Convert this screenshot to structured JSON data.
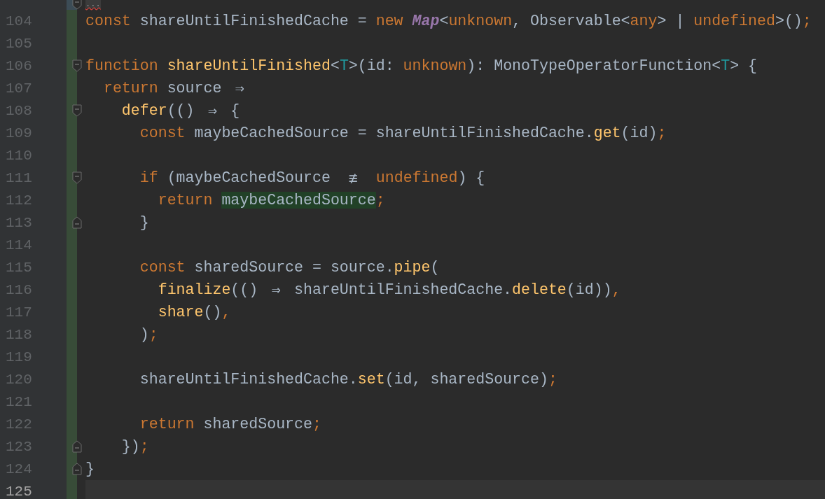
{
  "editor": {
    "lines": [
      {
        "kind": "fold-start",
        "current": false,
        "tokens": [
          {
            "t": "...",
            "kind": "folded"
          }
        ]
      },
      {
        "number": "104",
        "kind": "plain",
        "current": false,
        "tokens": [
          {
            "t": "const ",
            "kind": "kw"
          },
          {
            "t": "shareUntilFinishedCache = ",
            "kind": "plain"
          },
          {
            "t": "new ",
            "kind": "kw"
          },
          {
            "t": "Map",
            "kind": "class"
          },
          {
            "t": "<",
            "kind": "plain"
          },
          {
            "t": "unknown",
            "kind": "kw"
          },
          {
            "t": ", Observable<",
            "kind": "plain"
          },
          {
            "t": "any",
            "kind": "kw"
          },
          {
            "t": "> | ",
            "kind": "plain"
          },
          {
            "t": "undefined",
            "kind": "kw"
          },
          {
            "t": ">()",
            "kind": "plain"
          },
          {
            "t": ";",
            "kind": "kw"
          }
        ]
      },
      {
        "number": "105",
        "kind": "plain",
        "current": false
      },
      {
        "number": "106",
        "kind": "fold-start",
        "current": false,
        "tokens": [
          {
            "t": "function ",
            "kind": "kw"
          },
          {
            "t": "shareUntilFinished",
            "kind": "fn"
          },
          {
            "t": "<",
            "kind": "plain"
          },
          {
            "t": "T",
            "kind": "tparam"
          },
          {
            "t": ">(id: ",
            "kind": "plain"
          },
          {
            "t": "unknown",
            "kind": "kw"
          },
          {
            "t": "): MonoTypeOperatorFunction<",
            "kind": "plain"
          },
          {
            "t": "T",
            "kind": "tparam"
          },
          {
            "t": "> {",
            "kind": "plain"
          }
        ]
      },
      {
        "number": "107",
        "kind": "plain",
        "current": false,
        "tokens": [
          {
            "t": "  return ",
            "kind": "kw"
          },
          {
            "t": "source ",
            "kind": "plain"
          },
          {
            "t": "⇒",
            "kind": "arrow"
          }
        ]
      },
      {
        "number": "108",
        "kind": "fold-start",
        "current": false,
        "tokens": [
          {
            "t": "    defer",
            "kind": "fn"
          },
          {
            "t": "(() ",
            "kind": "plain"
          },
          {
            "t": "⇒",
            "kind": "arrow"
          },
          {
            "t": " {",
            "kind": "plain"
          }
        ]
      },
      {
        "number": "109",
        "kind": "plain",
        "current": false,
        "tokens": [
          {
            "t": "      const ",
            "kind": "kw"
          },
          {
            "t": "maybeCachedSource = shareUntilFinishedCache.",
            "kind": "plain"
          },
          {
            "t": "get",
            "kind": "fn"
          },
          {
            "t": "(id)",
            "kind": "plain"
          },
          {
            "t": ";",
            "kind": "kw"
          }
        ]
      },
      {
        "number": "110",
        "kind": "plain",
        "current": false
      },
      {
        "number": "111",
        "kind": "fold-start",
        "current": false,
        "tokens": [
          {
            "t": "      if ",
            "kind": "kw"
          },
          {
            "t": "(maybeCachedSource ",
            "kind": "plain"
          },
          {
            "t": "≢",
            "kind": "not-equal"
          },
          {
            "t": " undefined",
            "kind": "kw"
          },
          {
            "t": ") {",
            "kind": "plain"
          }
        ]
      },
      {
        "number": "112",
        "kind": "plain",
        "current": false,
        "tokens": [
          {
            "t": "        return ",
            "kind": "kw"
          },
          {
            "t": "maybeCachedSource",
            "kind": "highlight"
          },
          {
            "t": ";",
            "kind": "kw"
          }
        ]
      },
      {
        "number": "113",
        "kind": "fold-end",
        "current": false,
        "tokens": [
          {
            "t": "      }",
            "kind": "plain"
          }
        ]
      },
      {
        "number": "114",
        "kind": "plain",
        "current": false
      },
      {
        "number": "115",
        "kind": "plain",
        "current": false,
        "tokens": [
          {
            "t": "      const ",
            "kind": "kw"
          },
          {
            "t": "sharedSource = source.",
            "kind": "plain"
          },
          {
            "t": "pipe",
            "kind": "fn"
          },
          {
            "t": "(",
            "kind": "plain"
          }
        ]
      },
      {
        "number": "116",
        "kind": "plain",
        "current": false,
        "tokens": [
          {
            "t": "        finalize",
            "kind": "fn"
          },
          {
            "t": "(() ",
            "kind": "plain"
          },
          {
            "t": "⇒",
            "kind": "arrow"
          },
          {
            "t": " shareUntilFinishedCache.",
            "kind": "plain"
          },
          {
            "t": "delete",
            "kind": "fn"
          },
          {
            "t": "(id))",
            "kind": "plain"
          },
          {
            "t": ",",
            "kind": "kw"
          }
        ]
      },
      {
        "number": "117",
        "kind": "plain",
        "current": false,
        "tokens": [
          {
            "t": "        share",
            "kind": "fn"
          },
          {
            "t": "()",
            "kind": "plain"
          },
          {
            "t": ",",
            "kind": "kw"
          }
        ]
      },
      {
        "number": "118",
        "kind": "plain",
        "current": false,
        "tokens": [
          {
            "t": "      )",
            "kind": "plain"
          },
          {
            "t": ";",
            "kind": "kw"
          }
        ]
      },
      {
        "number": "119",
        "kind": "plain",
        "current": false
      },
      {
        "number": "120",
        "kind": "plain",
        "current": false,
        "tokens": [
          {
            "t": "      shareUntilFinishedCache.",
            "kind": "plain"
          },
          {
            "t": "set",
            "kind": "fn"
          },
          {
            "t": "(id, sharedSource)",
            "kind": "plain"
          },
          {
            "t": ";",
            "kind": "kw"
          }
        ]
      },
      {
        "number": "121",
        "kind": "plain",
        "current": false
      },
      {
        "number": "122",
        "kind": "plain",
        "current": false,
        "tokens": [
          {
            "t": "      return ",
            "kind": "kw"
          },
          {
            "t": "sharedSource",
            "kind": "plain"
          },
          {
            "t": ";",
            "kind": "kw"
          }
        ]
      },
      {
        "number": "123",
        "kind": "fold-end",
        "current": false,
        "tokens": [
          {
            "t": "    })",
            "kind": "plain"
          },
          {
            "t": ";",
            "kind": "kw"
          }
        ]
      },
      {
        "number": "124",
        "kind": "fold-end",
        "current": false,
        "tokens": [
          {
            "t": "}",
            "kind": "plain"
          }
        ]
      },
      {
        "number": "125",
        "kind": "plain",
        "current": true
      }
    ]
  }
}
